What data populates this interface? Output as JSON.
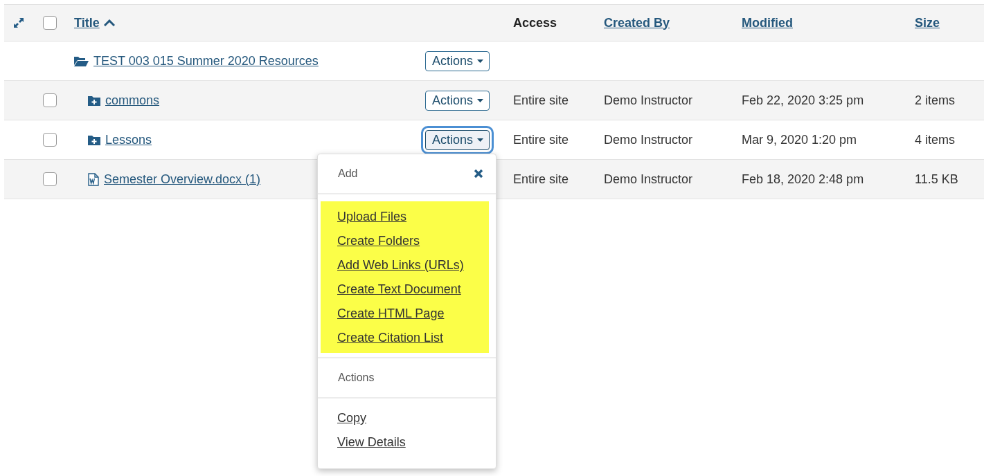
{
  "columns": [
    {
      "label": "Title",
      "kind": "link",
      "sorted": true
    },
    {
      "label": "Access",
      "kind": "plain",
      "sorted": false
    },
    {
      "label": "Created By",
      "kind": "link",
      "sorted": false
    },
    {
      "label": "Modified",
      "kind": "link",
      "sorted": false
    },
    {
      "label": "Size",
      "kind": "link",
      "sorted": false
    }
  ],
  "select_all": {
    "checked": false
  },
  "rows": [
    {
      "title": "TEST 003 015 Summer 2020 Resources",
      "kind": "parent-folder",
      "checkbox": false,
      "actions": {
        "label": "Actions",
        "focused": false
      },
      "children": [
        {
          "title": "commons",
          "kind": "folder",
          "checkbox": true,
          "checked": false,
          "actions": {
            "label": "Actions",
            "focused": false
          },
          "access": "Entire site",
          "created_by": "Demo Instructor",
          "modified": "Feb 22, 2020 3:25 pm",
          "size": "2 items"
        },
        {
          "title": "Lessons",
          "kind": "folder",
          "checkbox": true,
          "checked": false,
          "actions": {
            "label": "Actions",
            "focused": true
          },
          "access": "Entire site",
          "created_by": "Demo Instructor",
          "modified": "Mar 9, 2020 1:20 pm",
          "size": "4 items"
        },
        {
          "title": "Semester Overview.docx (1)",
          "kind": "file",
          "checkbox": true,
          "checked": false,
          "access": "Entire site",
          "created_by": "Demo Instructor",
          "modified": "Feb 18, 2020 2:48 pm",
          "size": "11.5 KB"
        }
      ]
    }
  ],
  "menu": {
    "sections": [
      {
        "heading": "Add",
        "closable": true,
        "highlighted": true,
        "items": [
          "Upload Files",
          "Create Folders",
          "Add Web Links (URLs)",
          "Create Text Document",
          "Create HTML Page",
          "Create Citation List"
        ]
      },
      {
        "heading": "Actions",
        "closable": false,
        "highlighted": false,
        "items": [
          "Copy",
          "View Details"
        ]
      }
    ]
  }
}
